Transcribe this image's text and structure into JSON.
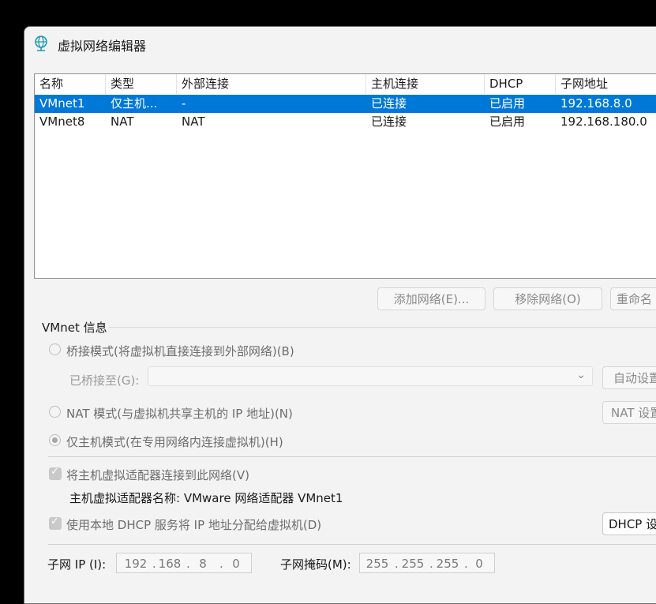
{
  "window": {
    "title": "虚拟网络编辑器"
  },
  "list": {
    "columns": [
      "名称",
      "类型",
      "外部连接",
      "主机连接",
      "DHCP",
      "子网地址"
    ],
    "rows": [
      {
        "name": "VMnet1",
        "type": "仅主机...",
        "external": "-",
        "host": "已连接",
        "dhcp": "已启用",
        "subnet": "192.168.8.0",
        "selected": true
      },
      {
        "name": "VMnet8",
        "type": "NAT",
        "external": "NAT",
        "host": "已连接",
        "dhcp": "已启用",
        "subnet": "192.168.180.0",
        "selected": false
      }
    ]
  },
  "buttons": {
    "add_network": "添加网络(E)...",
    "remove_network": "移除网络(O)",
    "rename_network": "重命名",
    "auto_settings": "自动设置",
    "nat_settings": "NAT 设置",
    "dhcp_settings": "DHCP 设"
  },
  "vmnet_info": {
    "group_title": "VMnet 信息",
    "bridged_label": "桥接模式(将虚拟机直接连接到外部网络)(B)",
    "bridged_to_label": "已桥接至(G):",
    "nat_label": "NAT 模式(与虚拟机共享主机的 IP 地址)(N)",
    "host_only_label": "仅主机模式(在专用网络内连接虚拟机)(H)",
    "connect_adapter_label": "将主机虚拟适配器连接到此网络(V)",
    "adapter_name_text": "主机虚拟适配器名称: VMware 网络适配器 VMnet1",
    "use_dhcp_label": "使用本地 DHCP 服务将 IP 地址分配给虚拟机(D)",
    "subnet_ip_label": "子网 IP (I):",
    "subnet_ip": [
      "192",
      "168",
      "8",
      "0"
    ],
    "subnet_mask_label": "子网掩码(M):",
    "subnet_mask": [
      "255",
      "255",
      "255",
      "0"
    ]
  },
  "colors": {
    "selection": "#0078d7",
    "window_bg": "#f3f3f3",
    "icon": "#1a9bb5"
  }
}
